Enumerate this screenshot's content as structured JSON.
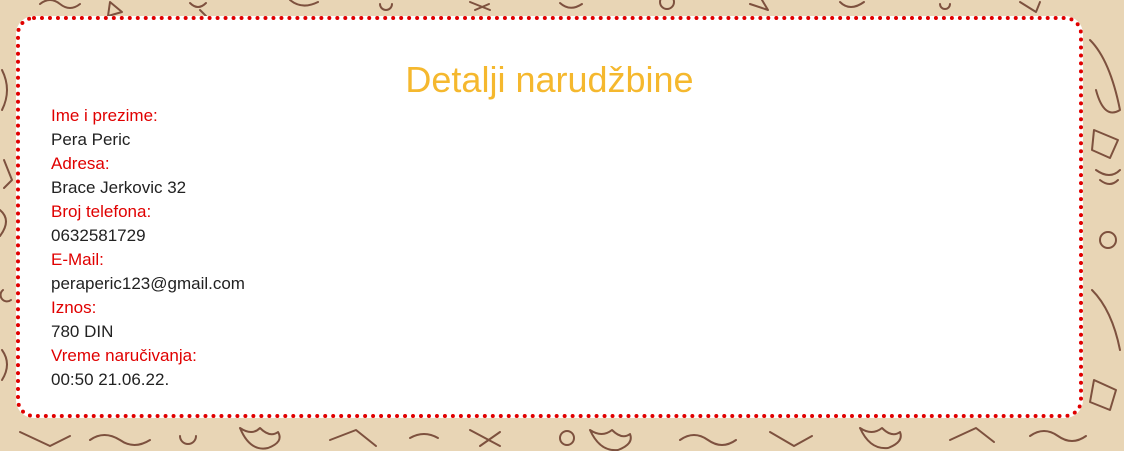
{
  "colors": {
    "background": "#e8d5b5",
    "doodle": "#6b3a2a",
    "card_border": "#e00000",
    "title": "#f5b82e",
    "label": "#e00000",
    "value": "#222222"
  },
  "order": {
    "title": "Detalji narudžbine",
    "fields": [
      {
        "label": "Ime i prezime:",
        "value": "Pera Peric"
      },
      {
        "label": "Adresa:",
        "value": "Brace Jerkovic 32"
      },
      {
        "label": "Broj telefona:",
        "value": "0632581729"
      },
      {
        "label": "E-Mail:",
        "value": "peraperic123@gmail.com"
      },
      {
        "label": "Iznos:",
        "value": "780 DIN"
      },
      {
        "label": "Vreme naručivanja:",
        "value": "00:50 21.06.22."
      }
    ]
  }
}
